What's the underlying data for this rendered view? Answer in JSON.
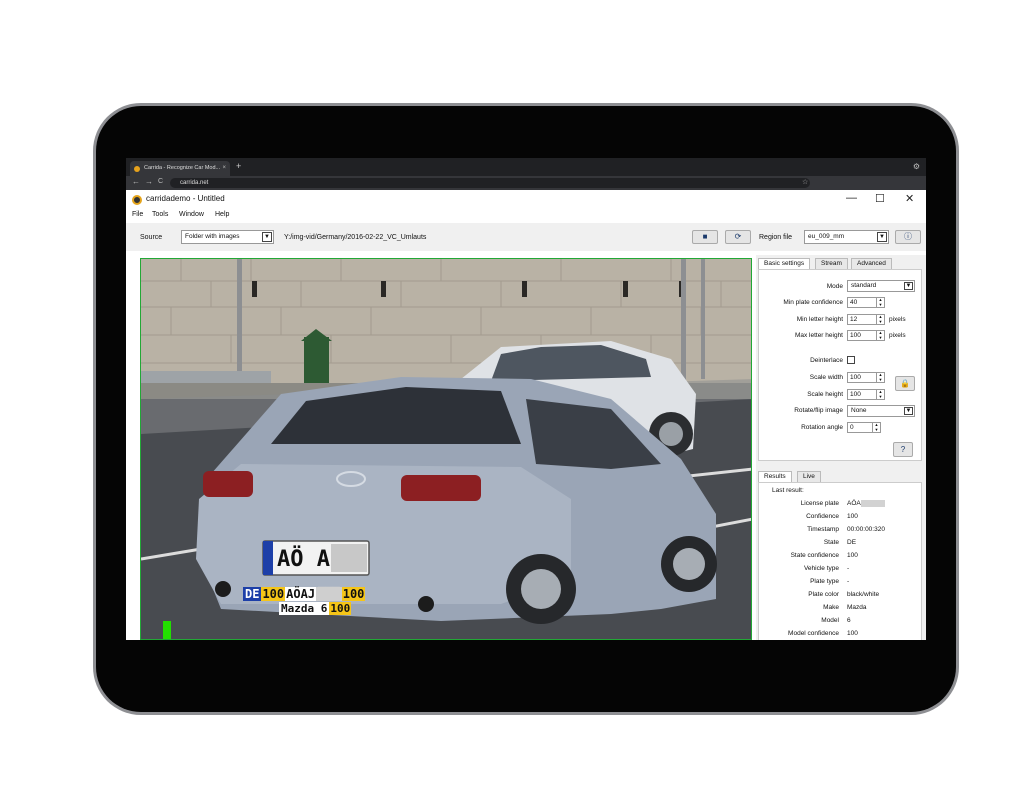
{
  "browser": {
    "tab_title": "Carrida - Recognize Car Mod...",
    "tab_close": "×",
    "new_tab": "+",
    "url": "carrida.net",
    "back": "←",
    "forward": "→",
    "reload": "C",
    "bookmark": "☆",
    "menu_icon": "⚙"
  },
  "window": {
    "title": "carridademo - Untitled",
    "minimize": "—",
    "maximize": "☐",
    "close": "✕"
  },
  "menu": {
    "file": "File",
    "tools": "Tools",
    "window": "Window",
    "help": "Help"
  },
  "toolbar": {
    "source_label": "Source",
    "source_value": "Folder with images",
    "path": "Y:/img-vid/Germany/2016-02-22_VC_Umlauts",
    "region_label": "Region file",
    "region_value": "eu_009_mm"
  },
  "settings": {
    "tabs": [
      "Basic settings",
      "Stream",
      "Advanced"
    ],
    "mode_label": "Mode",
    "mode_value": "standard",
    "min_plate_conf_label": "Min plate confidence",
    "min_plate_conf": "40",
    "min_letter_label": "Min letter height",
    "min_letter": "12",
    "max_letter_label": "Max letter height",
    "max_letter": "100",
    "pixels": "pixels",
    "deinterlace_label": "Deinterlace",
    "scale_width_label": "Scale width",
    "scale_width": "100",
    "scale_height_label": "Scale height",
    "scale_height": "100",
    "rotate_label": "Rotate/flip image",
    "rotate_value": "None",
    "angle_label": "Rotation angle",
    "angle": "0"
  },
  "results": {
    "tabs": [
      "Results",
      "Live"
    ],
    "last_result": "Last result:",
    "rows": [
      {
        "label": "License plate",
        "value": "AÖA"
      },
      {
        "label": "Confidence",
        "value": "100"
      },
      {
        "label": "Timestamp",
        "value": "00:00:00:320"
      },
      {
        "label": "State",
        "value": "DE"
      },
      {
        "label": "State confidence",
        "value": "100"
      },
      {
        "label": "Vehicle type",
        "value": "-"
      },
      {
        "label": "Plate type",
        "value": "-"
      },
      {
        "label": "Plate color",
        "value": "black/white"
      },
      {
        "label": "Make",
        "value": "Mazda"
      },
      {
        "label": "Model",
        "value": "6"
      },
      {
        "label": "Model confidence",
        "value": "100"
      }
    ]
  },
  "overlay": {
    "state": "DE",
    "state_conf": "100",
    "plate": "AÖAJ",
    "plate_conf": "100",
    "make_model": "Mazda 6",
    "make_conf": "100",
    "plate_text": "AÖ AJ"
  },
  "colors": {
    "accent": "#22a836",
    "overlay_yellow": "#f5c518",
    "overlay_blue": "#1d3fa8"
  }
}
